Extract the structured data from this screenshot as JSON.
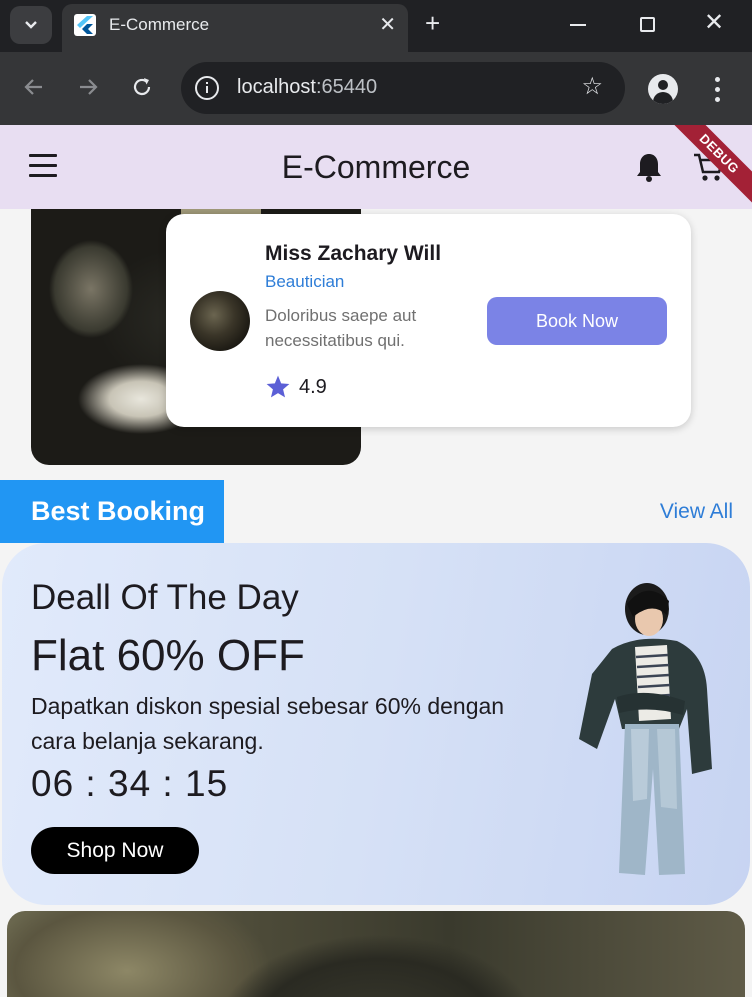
{
  "browser": {
    "tab_title": "E-Commerce",
    "url_host": "localhost",
    "url_port": ":65440"
  },
  "appbar": {
    "title": "E-Commerce",
    "debug_label": "DEBUG"
  },
  "doctor_card": {
    "name": "Miss Zachary Will",
    "role": "Beautician",
    "description": "Doloribus saepe aut necessitatibus qui.",
    "button_label": "Book Now",
    "rating": "4.9"
  },
  "section": {
    "title": "Best Booking",
    "view_all": "View All"
  },
  "deal": {
    "title": "Deall Of The Day",
    "discount": "Flat 60% OFF",
    "description": "Dapatkan diskon spesial sebesar 60% dengan cara belanja sekarang.",
    "timer": "06 : 34 : 15",
    "button_label": "Shop Now"
  },
  "colors": {
    "appbar_bg": "#e8def2",
    "accent_blue": "#2196f3",
    "book_button": "#7b83e6",
    "debug_ribbon": "#a32136"
  }
}
